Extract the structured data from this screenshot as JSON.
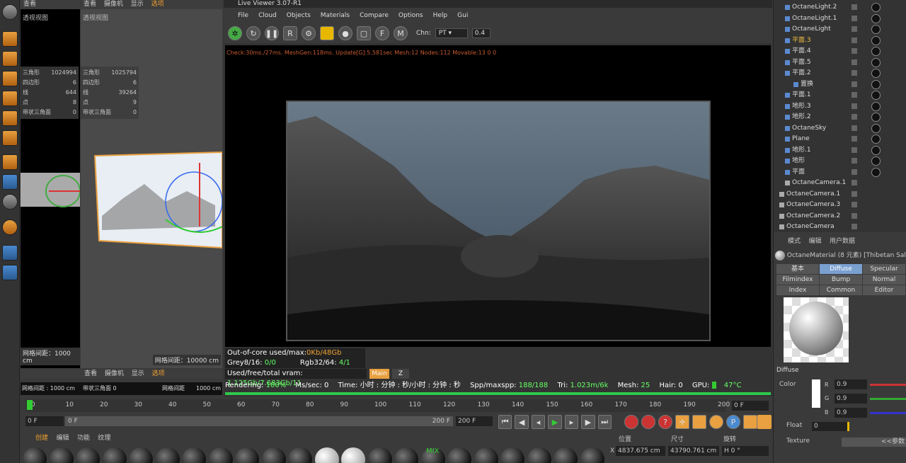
{
  "left_viewport": {
    "menu": [
      "查看",
      "摄像机",
      "显示",
      "选项"
    ],
    "menu_selected": "选项",
    "label": "透视视图",
    "stats": [
      [
        "三角形",
        "1024994"
      ],
      [
        "四边形",
        "6"
      ],
      [
        "线",
        "644"
      ],
      [
        "点",
        "8"
      ],
      [
        "带状三角面",
        "0"
      ]
    ],
    "grid": "网格间距：1000 cm"
  },
  "mid_viewport": {
    "menu": [
      "查看",
      "摄像机",
      "显示",
      "选项"
    ],
    "menu_selected": "选项",
    "label": "透视视图",
    "stats": [
      [
        "三角形",
        "1025794"
      ],
      [
        "四边形",
        "6"
      ],
      [
        "线",
        "39264"
      ],
      [
        "点",
        "9"
      ],
      [
        "带状三角面",
        "0"
      ]
    ],
    "grid": "网格间距：10000 cm"
  },
  "bottom_viewports": {
    "menu": [
      "查看",
      "摄像机",
      "显示",
      "选项"
    ],
    "grid_left": "网格间距 : 1000 cm",
    "tri_label": "带状三角面 0",
    "grid_mid": "网格间距",
    "grid_right": "1000 cm"
  },
  "live_viewer": {
    "title": "Live Viewer 3.07-R1",
    "menu": [
      "File",
      "Cloud",
      "Objects",
      "Materials",
      "Compare",
      "Options",
      "Help",
      "Gui"
    ],
    "chn_label": "Chn:",
    "chn_value": "PT",
    "chn_num": "0.4",
    "status": "Check:30ms./27ms. MeshGen:118ms. Update[G]:5.581sec Mesh:12 Nodes:112 Movable:13  0 0",
    "ooc": "Out-of-core used/max:",
    "ooc_val": "0Kb/48Gb",
    "grey": "Grey8/16: ",
    "grey_val": "0/0",
    "rgb": "Rgb32/64: ",
    "rgb_val": "4/1",
    "vram": "Used/free/total vram: ",
    "vram_val": "1.125Gb/7.683Gb/11",
    "main_btn": "Main",
    "z_btn": "Z",
    "rendering": "Rendering: ",
    "rendering_val": "100%",
    "mssec": "Ms/sec: 0",
    "time": "Time: 小时 : 分钟 : 秒/小时 : 分钟 : 秒",
    "spp": "Spp/maxspp: ",
    "spp_val": "188/188",
    "tri": "Tri: ",
    "tri_val": "1.023m/6k",
    "mesh": "Mesh: ",
    "mesh_val": "25",
    "hair": "Hair: 0",
    "gpu": "GPU: ",
    "temp": "47°C",
    "progress": 1.0
  },
  "objects": [
    {
      "name": "OctaneLight.2",
      "indent": 18
    },
    {
      "name": "OctaneLight.1",
      "indent": 18
    },
    {
      "name": "OctaneLight",
      "indent": 18
    },
    {
      "name": "平面.3",
      "indent": 18,
      "hl": true
    },
    {
      "name": "平面.4",
      "indent": 18
    },
    {
      "name": "平面.5",
      "indent": 18
    },
    {
      "name": "平面.2",
      "indent": 18
    },
    {
      "name": "置换",
      "indent": 30
    },
    {
      "name": "平面.1",
      "indent": 18
    },
    {
      "name": "地形.3",
      "indent": 18
    },
    {
      "name": "地形.2",
      "indent": 18
    },
    {
      "name": "OctaneSky",
      "indent": 18
    },
    {
      "name": "Plane",
      "indent": 18
    },
    {
      "name": "地形.1",
      "indent": 18
    },
    {
      "name": "地形",
      "indent": 18
    },
    {
      "name": "平面",
      "indent": 18
    },
    {
      "name": "OctaneCamera.1",
      "indent": 18
    },
    {
      "name": "OctaneCamera.1",
      "indent": 10
    },
    {
      "name": "OctaneCamera.3",
      "indent": 10
    },
    {
      "name": "OctaneCamera.2",
      "indent": 10
    },
    {
      "name": "OctaneCamera",
      "indent": 10
    }
  ],
  "attributes": {
    "menu": [
      "模式",
      "编辑",
      "用户数据"
    ],
    "material": "OctaneMaterial (8 元素) [Thibetan Salt , P",
    "tabs": [
      [
        "基本",
        "Diffuse",
        "Specular"
      ],
      [
        "Filmindex",
        "Bump",
        "Normal"
      ],
      [
        "Index",
        "Common",
        "Editor"
      ]
    ],
    "active_tab": "Diffuse",
    "section": "Diffuse",
    "color_label": "Color",
    "r": "0.9",
    "g": "0.9",
    "b": "0.9",
    "float_label": "Float",
    "float_val": "0",
    "texture_label": "Texture",
    "more": "<<参数"
  },
  "timeline": {
    "ticks": [
      "0",
      "10",
      "20",
      "30",
      "40",
      "50",
      "60",
      "70",
      "80",
      "90",
      "100",
      "110",
      "120",
      "130",
      "140",
      "150",
      "160",
      "170",
      "180",
      "190",
      "200"
    ],
    "current": "0 F",
    "start": "0 F",
    "range_start": "0 F",
    "range_end": "200 F",
    "end": "200 F"
  },
  "material_bar": {
    "menu": [
      "创建",
      "编辑",
      "功能",
      "纹理"
    ],
    "mix_label": "MIX"
  },
  "coords": {
    "headers": [
      "位置",
      "尺寸",
      "旋转"
    ],
    "x_label": "X",
    "x_pos": "4837.675 cm",
    "x_size": "43790.761 cm",
    "x_rot": "H 0 °"
  }
}
